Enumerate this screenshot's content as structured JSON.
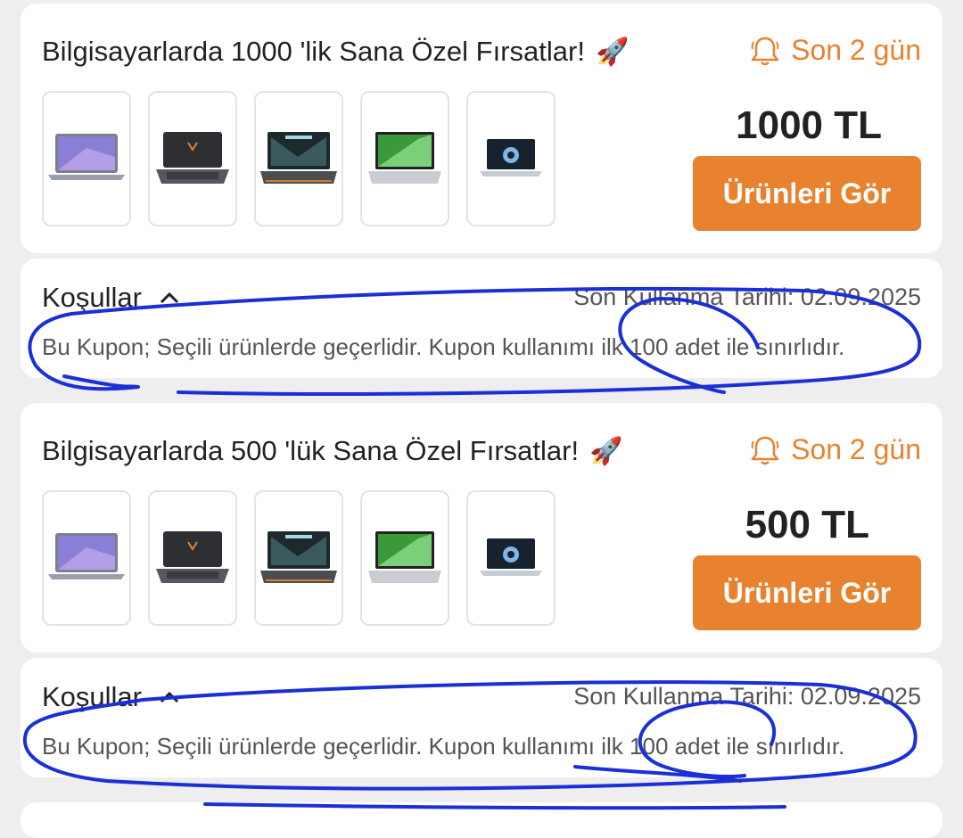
{
  "offers": [
    {
      "title": "Bilgisayarlarda 1000 'lik Sana Özel Fırsatlar!",
      "rocket": "🚀",
      "deadline": "Son 2 gün",
      "amount": "1000 TL",
      "cta": "Ürünleri Gör",
      "conditions": {
        "heading": "Koşullar",
        "expiry": "Son Kullanma Tarihi: 02.09.2025",
        "text": "Bu Kupon; Seçili ürünlerde geçerlidir. Kupon kullanımı ilk 100 adet ile sınırlıdır."
      }
    },
    {
      "title": "Bilgisayarlarda 500 'lük Sana Özel Fırsatlar!",
      "rocket": "🚀",
      "deadline": "Son 2 gün",
      "amount": "500 TL",
      "cta": "Ürünleri Gör",
      "conditions": {
        "heading": "Koşullar",
        "expiry": "Son Kullanma Tarihi: 02.09.2025",
        "text": "Bu Kupon; Seçili ürünlerde geçerlidir. Kupon kullanımı ilk 100 adet ile sınırlıdır."
      }
    }
  ],
  "colors": {
    "accent": "#e8822e",
    "annotation": "#1a2fd6"
  },
  "icons": {
    "deadline": "bell-icon",
    "conditions_toggle": "chevron-up-icon"
  }
}
